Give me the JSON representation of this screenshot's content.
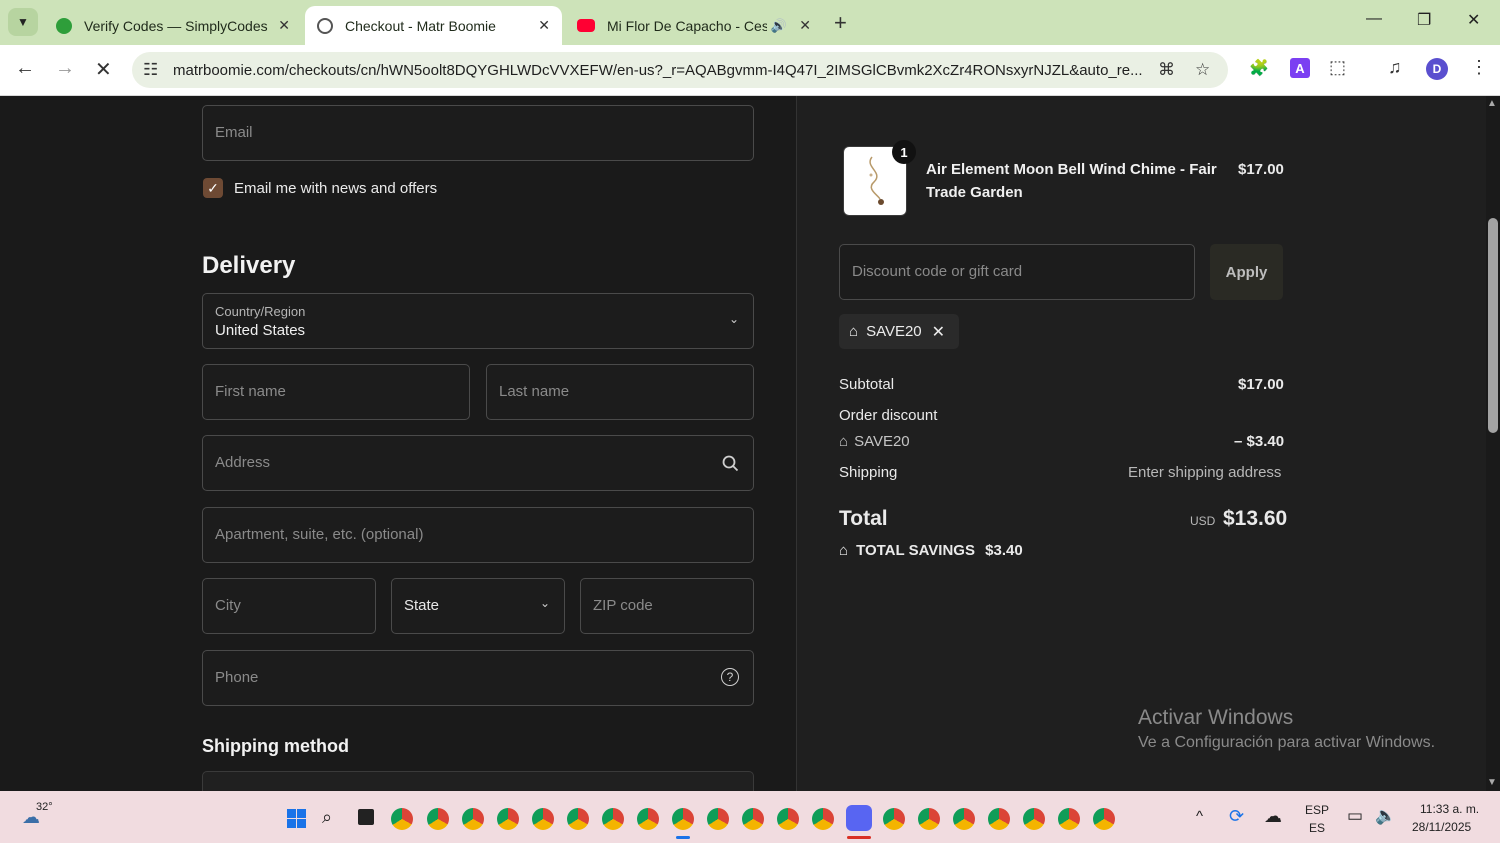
{
  "browser": {
    "tabs": [
      {
        "title": "Verify Codes — SimplyCodes",
        "favicon_color": "#2e9e3a"
      },
      {
        "title": "Checkout - Matr Boomie",
        "favicon_color": "#555555"
      },
      {
        "title": "Mi Flor De Capacho - Cesar",
        "favicon_color": "#ff0033"
      }
    ],
    "url": "matrboomie.com/checkouts/cn/hWN5oolt8DQYGHLWDcVVXEFW/en-us?_r=AQABgvmm-I4Q47I_2IMSGlCBvmk2XcZr4RONsxyrNJZL&auto_re...",
    "profile_initial": "D"
  },
  "checkout": {
    "email_placeholder": "Email",
    "newsletter_label": "Email me with news and offers",
    "delivery_heading": "Delivery",
    "country_label": "Country/Region",
    "country_value": "United States",
    "first_name_placeholder": "First name",
    "last_name_placeholder": "Last name",
    "address_placeholder": "Address",
    "apartment_placeholder": "Apartment, suite, etc. (optional)",
    "city_placeholder": "City",
    "state_label": "State",
    "zip_placeholder": "ZIP code",
    "phone_placeholder": "Phone",
    "shipping_method_heading": "Shipping method"
  },
  "summary": {
    "item": {
      "quantity": "1",
      "name_line1": "Air Element Moon Bell Wind Chime - Fair",
      "name_line2": "Trade Garden",
      "price": "$17.00"
    },
    "discount_placeholder": "Discount code or gift card",
    "apply_label": "Apply",
    "applied_code": "SAVE20",
    "subtotal_label": "Subtotal",
    "subtotal_value": "$17.00",
    "order_discount_label": "Order discount",
    "discount_code": "SAVE20",
    "discount_value": "– $3.40",
    "shipping_label": "Shipping",
    "shipping_value": "Enter shipping address",
    "total_label": "Total",
    "currency": "USD",
    "total_value": "$13.60",
    "total_savings_label": "TOTAL SAVINGS",
    "total_savings_value": "$3.40"
  },
  "watermark": {
    "line1": "Activar Windows",
    "line2": "Ve a Configuración para activar Windows."
  },
  "taskbar": {
    "weather": "32°",
    "lang_line1": "ESP",
    "lang_line2": "ES",
    "time": "11:33 a. m.",
    "date": "28/11/2025"
  }
}
